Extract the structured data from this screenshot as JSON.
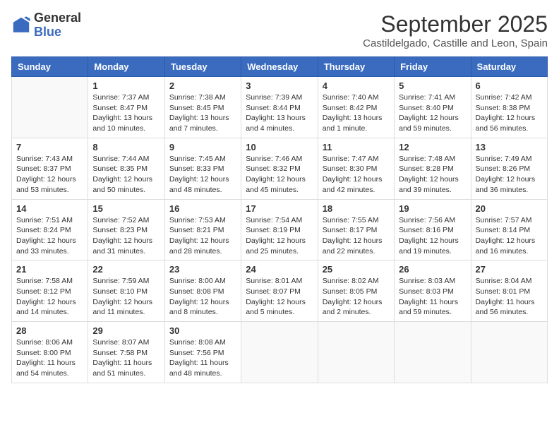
{
  "header": {
    "logo_general": "General",
    "logo_blue": "Blue",
    "month_title": "September 2025",
    "location": "Castildelgado, Castille and Leon, Spain"
  },
  "weekdays": [
    "Sunday",
    "Monday",
    "Tuesday",
    "Wednesday",
    "Thursday",
    "Friday",
    "Saturday"
  ],
  "weeks": [
    [
      {
        "day": "",
        "info": ""
      },
      {
        "day": "1",
        "info": "Sunrise: 7:37 AM\nSunset: 8:47 PM\nDaylight: 13 hours\nand 10 minutes."
      },
      {
        "day": "2",
        "info": "Sunrise: 7:38 AM\nSunset: 8:45 PM\nDaylight: 13 hours\nand 7 minutes."
      },
      {
        "day": "3",
        "info": "Sunrise: 7:39 AM\nSunset: 8:44 PM\nDaylight: 13 hours\nand 4 minutes."
      },
      {
        "day": "4",
        "info": "Sunrise: 7:40 AM\nSunset: 8:42 PM\nDaylight: 13 hours\nand 1 minute."
      },
      {
        "day": "5",
        "info": "Sunrise: 7:41 AM\nSunset: 8:40 PM\nDaylight: 12 hours\nand 59 minutes."
      },
      {
        "day": "6",
        "info": "Sunrise: 7:42 AM\nSunset: 8:38 PM\nDaylight: 12 hours\nand 56 minutes."
      }
    ],
    [
      {
        "day": "7",
        "info": "Sunrise: 7:43 AM\nSunset: 8:37 PM\nDaylight: 12 hours\nand 53 minutes."
      },
      {
        "day": "8",
        "info": "Sunrise: 7:44 AM\nSunset: 8:35 PM\nDaylight: 12 hours\nand 50 minutes."
      },
      {
        "day": "9",
        "info": "Sunrise: 7:45 AM\nSunset: 8:33 PM\nDaylight: 12 hours\nand 48 minutes."
      },
      {
        "day": "10",
        "info": "Sunrise: 7:46 AM\nSunset: 8:32 PM\nDaylight: 12 hours\nand 45 minutes."
      },
      {
        "day": "11",
        "info": "Sunrise: 7:47 AM\nSunset: 8:30 PM\nDaylight: 12 hours\nand 42 minutes."
      },
      {
        "day": "12",
        "info": "Sunrise: 7:48 AM\nSunset: 8:28 PM\nDaylight: 12 hours\nand 39 minutes."
      },
      {
        "day": "13",
        "info": "Sunrise: 7:49 AM\nSunset: 8:26 PM\nDaylight: 12 hours\nand 36 minutes."
      }
    ],
    [
      {
        "day": "14",
        "info": "Sunrise: 7:51 AM\nSunset: 8:24 PM\nDaylight: 12 hours\nand 33 minutes."
      },
      {
        "day": "15",
        "info": "Sunrise: 7:52 AM\nSunset: 8:23 PM\nDaylight: 12 hours\nand 31 minutes."
      },
      {
        "day": "16",
        "info": "Sunrise: 7:53 AM\nSunset: 8:21 PM\nDaylight: 12 hours\nand 28 minutes."
      },
      {
        "day": "17",
        "info": "Sunrise: 7:54 AM\nSunset: 8:19 PM\nDaylight: 12 hours\nand 25 minutes."
      },
      {
        "day": "18",
        "info": "Sunrise: 7:55 AM\nSunset: 8:17 PM\nDaylight: 12 hours\nand 22 minutes."
      },
      {
        "day": "19",
        "info": "Sunrise: 7:56 AM\nSunset: 8:16 PM\nDaylight: 12 hours\nand 19 minutes."
      },
      {
        "day": "20",
        "info": "Sunrise: 7:57 AM\nSunset: 8:14 PM\nDaylight: 12 hours\nand 16 minutes."
      }
    ],
    [
      {
        "day": "21",
        "info": "Sunrise: 7:58 AM\nSunset: 8:12 PM\nDaylight: 12 hours\nand 14 minutes."
      },
      {
        "day": "22",
        "info": "Sunrise: 7:59 AM\nSunset: 8:10 PM\nDaylight: 12 hours\nand 11 minutes."
      },
      {
        "day": "23",
        "info": "Sunrise: 8:00 AM\nSunset: 8:08 PM\nDaylight: 12 hours\nand 8 minutes."
      },
      {
        "day": "24",
        "info": "Sunrise: 8:01 AM\nSunset: 8:07 PM\nDaylight: 12 hours\nand 5 minutes."
      },
      {
        "day": "25",
        "info": "Sunrise: 8:02 AM\nSunset: 8:05 PM\nDaylight: 12 hours\nand 2 minutes."
      },
      {
        "day": "26",
        "info": "Sunrise: 8:03 AM\nSunset: 8:03 PM\nDaylight: 11 hours\nand 59 minutes."
      },
      {
        "day": "27",
        "info": "Sunrise: 8:04 AM\nSunset: 8:01 PM\nDaylight: 11 hours\nand 56 minutes."
      }
    ],
    [
      {
        "day": "28",
        "info": "Sunrise: 8:06 AM\nSunset: 8:00 PM\nDaylight: 11 hours\nand 54 minutes."
      },
      {
        "day": "29",
        "info": "Sunrise: 8:07 AM\nSunset: 7:58 PM\nDaylight: 11 hours\nand 51 minutes."
      },
      {
        "day": "30",
        "info": "Sunrise: 8:08 AM\nSunset: 7:56 PM\nDaylight: 11 hours\nand 48 minutes."
      },
      {
        "day": "",
        "info": ""
      },
      {
        "day": "",
        "info": ""
      },
      {
        "day": "",
        "info": ""
      },
      {
        "day": "",
        "info": ""
      }
    ]
  ]
}
